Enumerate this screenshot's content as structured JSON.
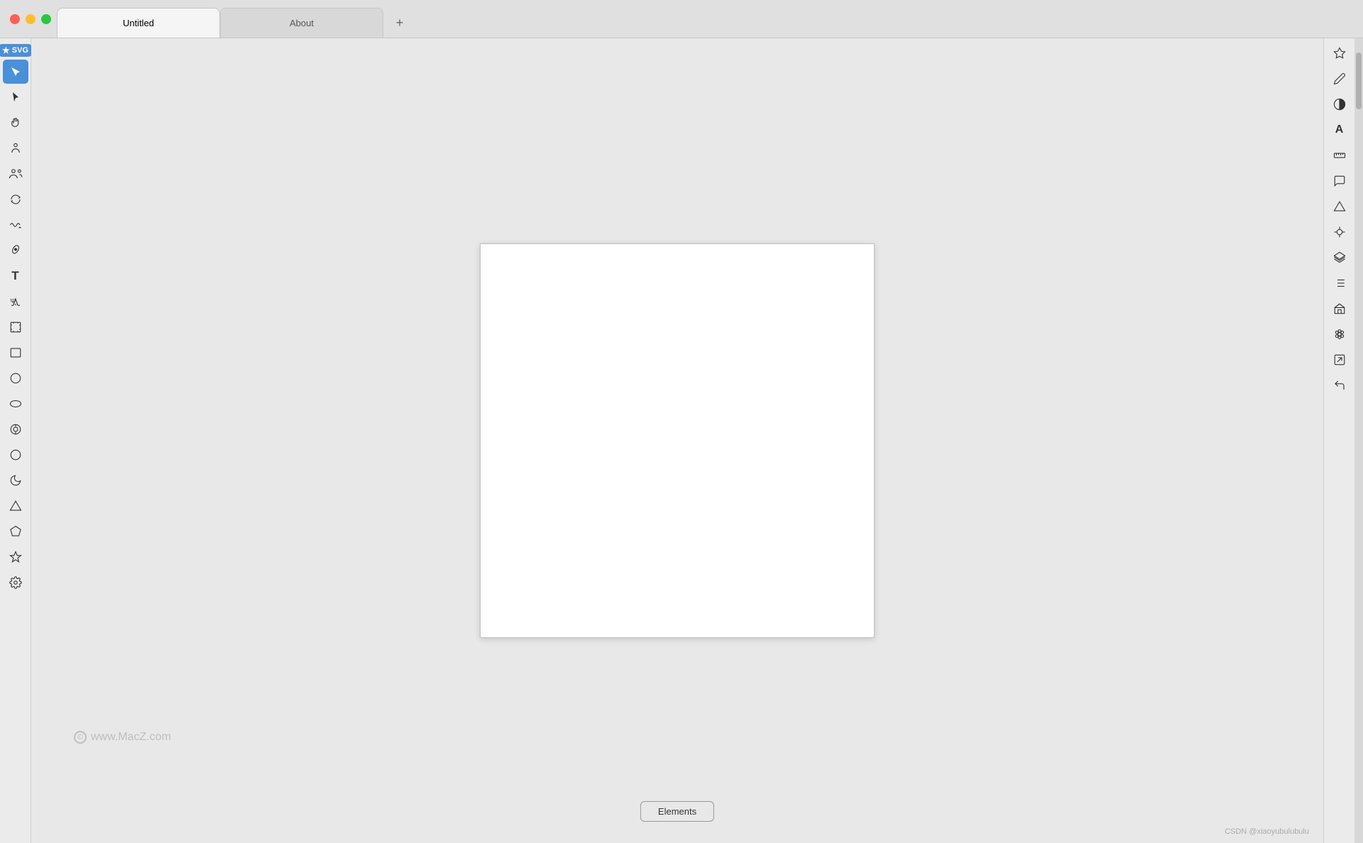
{
  "titlebar": {
    "tabs": [
      {
        "id": "untitled",
        "label": "Untitled",
        "active": true
      },
      {
        "id": "about",
        "label": "About",
        "active": false
      }
    ],
    "add_tab_label": "+"
  },
  "svg_badge": {
    "icon": "★",
    "label": "SVG"
  },
  "left_tools": [
    {
      "name": "select-tool",
      "icon": "↖",
      "active": true,
      "label": "Select"
    },
    {
      "name": "pointer-tool",
      "icon": "▲",
      "active": false,
      "label": "Pointer"
    },
    {
      "name": "hand-tool",
      "icon": "✋",
      "active": false,
      "label": "Hand"
    },
    {
      "name": "user-tool",
      "icon": "☺",
      "active": false,
      "label": "Person"
    },
    {
      "name": "users-tool",
      "icon": "☻",
      "active": false,
      "label": "People"
    },
    {
      "name": "loop-tool",
      "icon": "↺",
      "active": false,
      "label": "Loop"
    },
    {
      "name": "path-tool",
      "icon": "〜",
      "active": false,
      "label": "Path"
    },
    {
      "name": "pen-tool",
      "icon": "✒",
      "active": false,
      "label": "Pen"
    },
    {
      "name": "text-tool",
      "icon": "T",
      "active": false,
      "label": "Text"
    },
    {
      "name": "text-format-tool",
      "icon": "Ʃ",
      "active": false,
      "label": "Text Format"
    },
    {
      "name": "expand-tool",
      "icon": "⊡",
      "active": false,
      "label": "Expand"
    },
    {
      "name": "rectangle-tool",
      "icon": "□",
      "active": false,
      "label": "Rectangle"
    },
    {
      "name": "circle-tool",
      "icon": "○",
      "active": false,
      "label": "Circle"
    },
    {
      "name": "ellipse-tool",
      "icon": "⬭",
      "active": false,
      "label": "Ellipse"
    },
    {
      "name": "target-tool",
      "icon": "◎",
      "active": false,
      "label": "Target"
    },
    {
      "name": "crescent-tool",
      "icon": "☽",
      "active": false,
      "label": "Crescent"
    },
    {
      "name": "moon-tool",
      "icon": "☾",
      "active": false,
      "label": "Moon"
    },
    {
      "name": "triangle-tool",
      "icon": "△",
      "active": false,
      "label": "Triangle"
    },
    {
      "name": "pentagon-tool",
      "icon": "⬠",
      "active": false,
      "label": "Pentagon"
    },
    {
      "name": "star-tool",
      "icon": "★",
      "active": false,
      "label": "Star"
    },
    {
      "name": "gear-tool",
      "icon": "⚙",
      "active": false,
      "label": "Gear"
    }
  ],
  "right_tools": [
    {
      "name": "style-tool",
      "icon": "✦",
      "label": "Style"
    },
    {
      "name": "pencil-tool",
      "icon": "✏",
      "label": "Pencil"
    },
    {
      "name": "contrast-tool",
      "icon": "◑",
      "label": "Contrast"
    },
    {
      "name": "font-tool",
      "icon": "A",
      "label": "Font"
    },
    {
      "name": "ruler-tool",
      "icon": "📐",
      "label": "Ruler"
    },
    {
      "name": "comment-tool",
      "icon": "💬",
      "label": "Comment"
    },
    {
      "name": "delta-tool",
      "icon": "△",
      "label": "Delta"
    },
    {
      "name": "crosshair-tool",
      "icon": "⊕",
      "label": "Crosshair"
    },
    {
      "name": "layers-tool",
      "icon": "≡",
      "label": "Layers"
    },
    {
      "name": "grid-tool",
      "icon": "⊞",
      "label": "Grid"
    },
    {
      "name": "building-tool",
      "icon": "⌂",
      "label": "Building"
    },
    {
      "name": "settings-tool",
      "icon": "✿",
      "label": "Settings"
    },
    {
      "name": "export-tool",
      "icon": "↗",
      "label": "Export"
    },
    {
      "name": "back-tool",
      "icon": "↩",
      "label": "Back"
    }
  ],
  "canvas": {
    "watermark": "www.MacZ.com",
    "copyright_symbol": "©"
  },
  "bottom": {
    "elements_button": "Elements",
    "attribution": "CSDN @xiaoyubulubulu"
  }
}
